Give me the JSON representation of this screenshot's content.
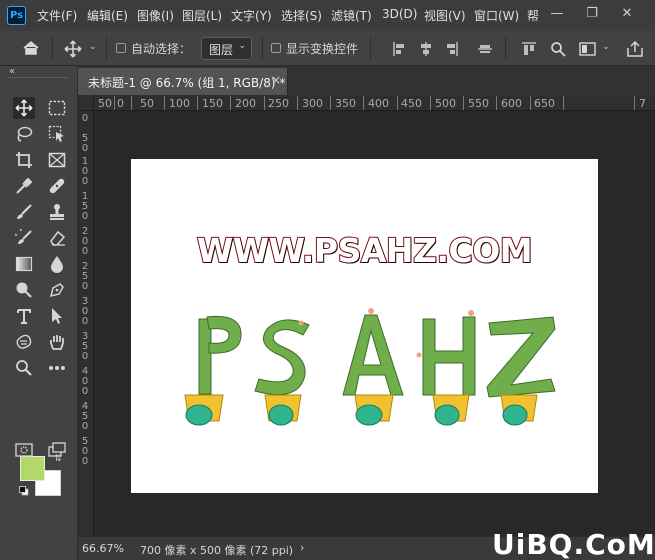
{
  "app": {
    "logo_text": "Ps"
  },
  "menu": [
    "文件(F)",
    "编辑(E)",
    "图像(I)",
    "图层(L)",
    "文字(Y)",
    "选择(S)",
    "滤镜(T)",
    "3D(D)",
    "视图(V)",
    "窗口(W)",
    "帮"
  ],
  "window_controls": {
    "minimize": "—",
    "restore": "❐",
    "close": "✕"
  },
  "options": {
    "auto_select_label": "自动选择：",
    "layer_dropdown_value": "图层",
    "show_transform_label": "显示变换控件"
  },
  "toolbar": {
    "collapse": "«",
    "fg_color": "#b3d86a",
    "bg_color": "#ffffff"
  },
  "document": {
    "tab_title": "未标题-1 @ 66.7% (组 1, RGB/8) *",
    "close": "×"
  },
  "ruler": {
    "horizontal": [
      "50",
      "0",
      "50",
      "100",
      "150",
      "200",
      "250",
      "300",
      "350",
      "400",
      "450",
      "500",
      "550",
      "600",
      "650",
      "7"
    ],
    "vertical": [
      "0",
      "5 0",
      "1 0 0",
      "1 5 0",
      "2 0 0",
      "2 5 0",
      "3 0 0",
      "3 5 0",
      "4 0 0",
      "4 5 0",
      "5 0 0"
    ]
  },
  "canvas": {
    "headline": "WWW.PSAHZ.COM",
    "title_stroke_color": "#7a0c14",
    "cactus_letters": "PSAHZ"
  },
  "status": {
    "zoom": "66.67%",
    "doc_info": "700 像素 x 500 像素 (72 ppi)",
    "arrow": "›"
  },
  "watermark": "UiBQ.CoM"
}
